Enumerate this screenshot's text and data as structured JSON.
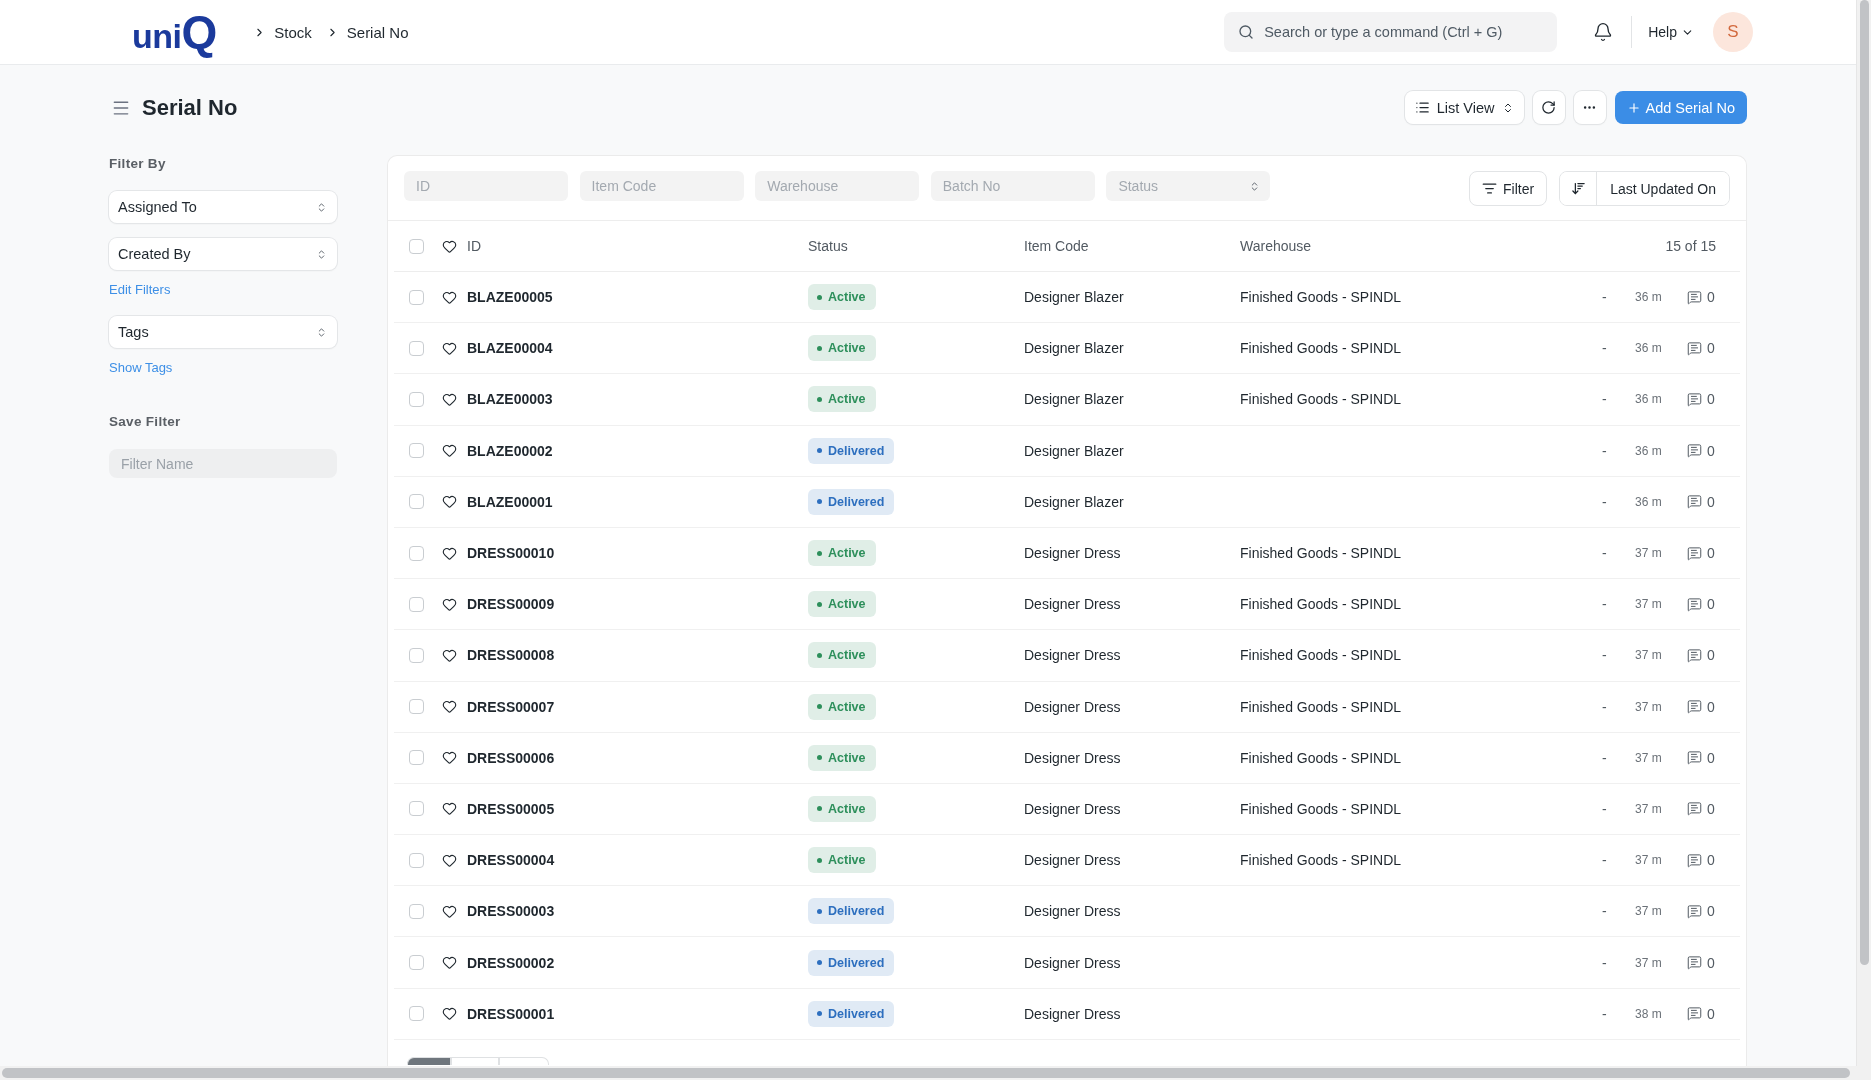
{
  "navbar": {
    "logo": "uniQ",
    "breadcrumbs": [
      "Stock",
      "Serial No"
    ],
    "search": {
      "placeholder": "Search or type a command (Ctrl + G)"
    },
    "help_menu": "Help",
    "avatar_initial": "S"
  },
  "page_header": {
    "title": "Serial No",
    "view_switcher": "List View",
    "primary_action": "Add Serial No"
  },
  "sidebar": {
    "heading": "Filter By",
    "items": [
      {
        "kind": "select",
        "label": "Assigned To"
      },
      {
        "kind": "select",
        "label": "Created By"
      },
      {
        "kind": "link",
        "label": "Edit Filters"
      },
      {
        "kind": "select",
        "label": "Tags"
      },
      {
        "kind": "link",
        "label": "Show Tags"
      }
    ],
    "save_filter": {
      "heading": "Save Filter",
      "placeholder": "Filter Name"
    }
  },
  "list": {
    "filters": [
      {
        "kind": "input",
        "placeholder": "ID"
      },
      {
        "kind": "input",
        "placeholder": "Item Code"
      },
      {
        "kind": "input",
        "placeholder": "Warehouse"
      },
      {
        "kind": "input",
        "placeholder": "Batch No"
      },
      {
        "kind": "select",
        "placeholder": "Status"
      }
    ],
    "filter_button": "Filter",
    "sort_by": "Last Updated On",
    "select_all_checked": false,
    "columns": [
      "ID",
      "Status",
      "Item Code",
      "Warehouse"
    ],
    "count": "15 of 15",
    "rows": [
      {
        "id": "BLAZE00005",
        "checked": false,
        "liked": false,
        "status": {
          "text": "Active",
          "color": "#2d8f5b"
        },
        "item_code": "Designer Blazer",
        "warehouse": "Finished Goods - SPINDL",
        "column_5": "-",
        "modified": "36 m",
        "comments": "0"
      },
      {
        "id": "BLAZE00004",
        "checked": false,
        "liked": false,
        "status": {
          "text": "Active",
          "color": "#2d8f5b"
        },
        "item_code": "Designer Blazer",
        "warehouse": "Finished Goods - SPINDL",
        "column_5": "-",
        "modified": "36 m",
        "comments": "0"
      },
      {
        "id": "BLAZE00003",
        "checked": false,
        "liked": false,
        "status": {
          "text": "Active",
          "color": "#2d8f5b"
        },
        "item_code": "Designer Blazer",
        "warehouse": "Finished Goods - SPINDL",
        "column_5": "-",
        "modified": "36 m",
        "comments": "0"
      },
      {
        "id": "BLAZE00002",
        "checked": false,
        "liked": false,
        "status": {
          "text": "Delivered",
          "color": "#2d6fbf"
        },
        "item_code": "Designer Blazer",
        "column_5": "-",
        "modified": "36 m",
        "comments": "0"
      },
      {
        "id": "BLAZE00001",
        "checked": false,
        "liked": false,
        "status": {
          "text": "Delivered",
          "color": "#2d6fbf"
        },
        "item_code": "Designer Blazer",
        "column_5": "-",
        "modified": "36 m",
        "comments": "0"
      },
      {
        "id": "DRESS00010",
        "checked": false,
        "liked": false,
        "status": {
          "text": "Active",
          "color": "#2d8f5b"
        },
        "item_code": "Designer Dress",
        "warehouse": "Finished Goods - SPINDL",
        "column_5": "-",
        "modified": "37 m",
        "comments": "0"
      },
      {
        "id": "DRESS00009",
        "checked": false,
        "liked": false,
        "status": {
          "text": "Active",
          "color": "#2d8f5b"
        },
        "item_code": "Designer Dress",
        "warehouse": "Finished Goods - SPINDL",
        "column_5": "-",
        "modified": "37 m",
        "comments": "0"
      },
      {
        "id": "DRESS00008",
        "checked": false,
        "liked": false,
        "status": {
          "text": "Active",
          "color": "#2d8f5b"
        },
        "item_code": "Designer Dress",
        "warehouse": "Finished Goods - SPINDL",
        "column_5": "-",
        "modified": "37 m",
        "comments": "0"
      },
      {
        "id": "DRESS00007",
        "checked": false,
        "liked": false,
        "status": {
          "text": "Active",
          "color": "#2d8f5b"
        },
        "item_code": "Designer Dress",
        "warehouse": "Finished Goods - SPINDL",
        "column_5": "-",
        "modified": "37 m",
        "comments": "0"
      },
      {
        "id": "DRESS00006",
        "checked": false,
        "liked": false,
        "status": {
          "text": "Active",
          "color": "#2d8f5b"
        },
        "item_code": "Designer Dress",
        "warehouse": "Finished Goods - SPINDL",
        "column_5": "-",
        "modified": "37 m",
        "comments": "0"
      },
      {
        "id": "DRESS00005",
        "checked": false,
        "liked": false,
        "status": {
          "text": "Active",
          "color": "#2d8f5b"
        },
        "item_code": "Designer Dress",
        "warehouse": "Finished Goods - SPINDL",
        "column_5": "-",
        "modified": "37 m",
        "comments": "0"
      },
      {
        "id": "DRESS00004",
        "checked": false,
        "liked": false,
        "status": {
          "text": "Active",
          "color": "#2d8f5b"
        },
        "item_code": "Designer Dress",
        "warehouse": "Finished Goods - SPINDL",
        "column_5": "-",
        "modified": "37 m",
        "comments": "0"
      },
      {
        "id": "DRESS00003",
        "checked": false,
        "liked": false,
        "status": {
          "text": "Delivered",
          "color": "#2d6fbf"
        },
        "item_code": "Designer Dress",
        "column_5": "-",
        "modified": "37 m",
        "comments": "0"
      },
      {
        "id": "DRESS00002",
        "checked": false,
        "liked": false,
        "status": {
          "text": "Delivered",
          "color": "#2d6fbf"
        },
        "item_code": "Designer Dress",
        "column_5": "-",
        "modified": "37 m",
        "comments": "0"
      },
      {
        "id": "DRESS00001",
        "checked": false,
        "liked": false,
        "status": {
          "text": "Delivered",
          "color": "#2d6fbf"
        },
        "item_code": "Designer Dress",
        "column_5": "-",
        "modified": "38 m",
        "comments": "0"
      }
    ],
    "page_length_options": [
      {
        "selected": true
      },
      {
        "selected": false
      },
      {
        "selected": false
      }
    ]
  }
}
